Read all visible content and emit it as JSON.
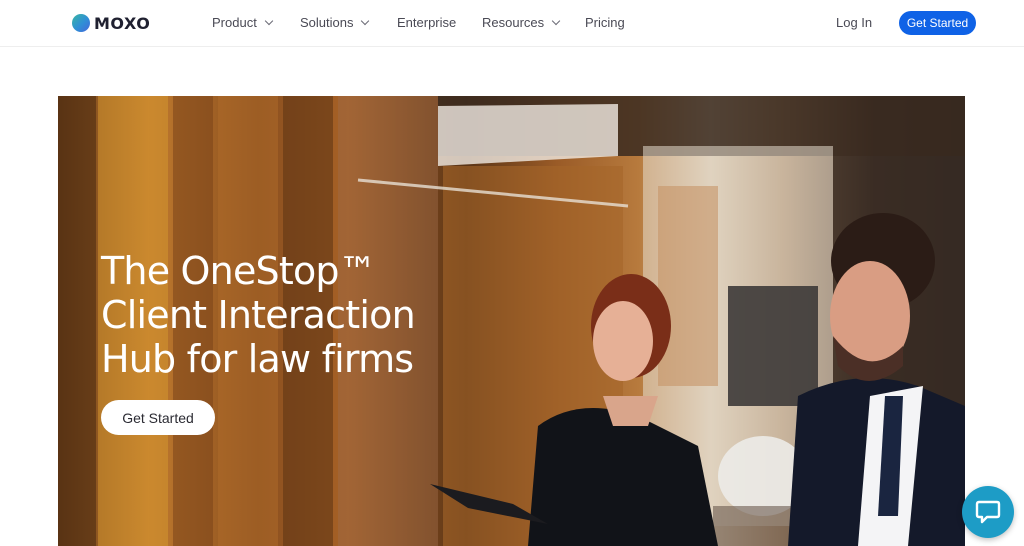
{
  "header": {
    "logo_text": "MOXO",
    "nav": [
      {
        "label": "Product",
        "has_dropdown": true
      },
      {
        "label": "Solutions",
        "has_dropdown": true
      },
      {
        "label": "Enterprise",
        "has_dropdown": false
      },
      {
        "label": "Resources",
        "has_dropdown": true
      },
      {
        "label": "Pricing",
        "has_dropdown": false
      }
    ],
    "login_label": "Log In",
    "cta_label": "Get Started"
  },
  "hero": {
    "title_lines": [
      "The OneStop™",
      "Client Interaction",
      "Hub for law firms"
    ],
    "cta_label": "Get Started",
    "image_description_icon": "office-photo"
  },
  "chat_widget": {
    "icon": "chat-bubble-icon"
  },
  "colors": {
    "primary": "#0f62e6",
    "chat": "#1d9cc6",
    "text": "#2b2b33"
  }
}
